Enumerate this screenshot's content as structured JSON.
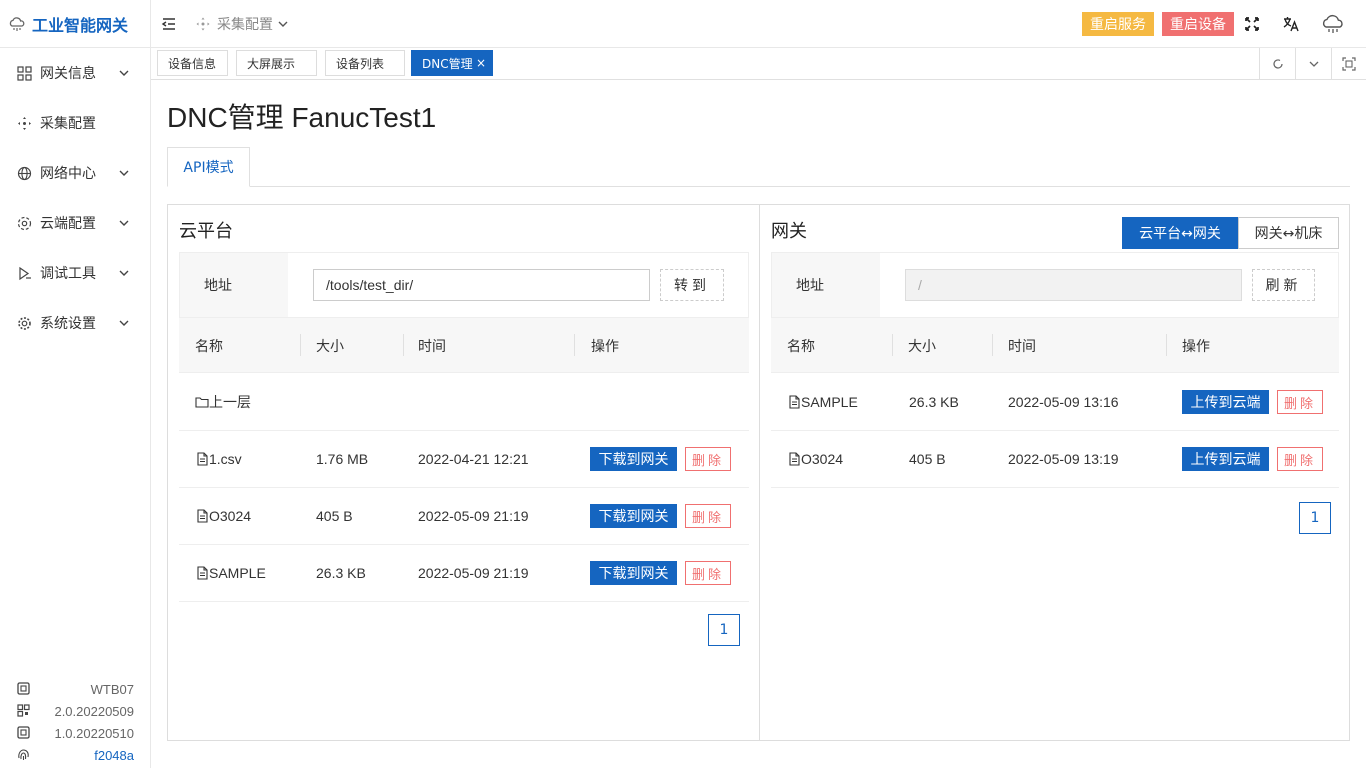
{
  "app": {
    "title": "工业智能网关"
  },
  "sidebar": {
    "items": [
      {
        "label": "网关信息",
        "icon": "grid-icon",
        "has_submenu": true
      },
      {
        "label": "采集配置",
        "icon": "move-icon",
        "has_submenu": false
      },
      {
        "label": "网络中心",
        "icon": "globe-icon",
        "has_submenu": true
      },
      {
        "label": "云端配置",
        "icon": "dataset-icon",
        "has_submenu": true
      },
      {
        "label": "调试工具",
        "icon": "debug-icon",
        "has_submenu": true
      },
      {
        "label": "系统设置",
        "icon": "settings-icon",
        "has_submenu": true
      }
    ],
    "info": [
      {
        "value": "WTB07",
        "icon": "chip-icon"
      },
      {
        "value": "2.0.20220509",
        "icon": "qr-icon"
      },
      {
        "value": "1.0.20220510",
        "icon": "chip-icon"
      },
      {
        "value": "f2048a",
        "icon": "fingerprint-icon"
      }
    ]
  },
  "header": {
    "breadcrumb": "采集配置",
    "restart_service": "重启服务",
    "restart_device": "重启设备"
  },
  "tabs": [
    {
      "label": "设备信息",
      "active": false
    },
    {
      "label": "大屏展示",
      "active": false
    },
    {
      "label": "设备列表",
      "active": false
    },
    {
      "label": "DNC管理",
      "active": true,
      "close": "×"
    }
  ],
  "page": {
    "title": "DNC管理 FanucTest1",
    "mode_tab": "API模式"
  },
  "cloud": {
    "heading": "云平台",
    "addr_label": "地址",
    "addr_value": "/tools/test_dir/",
    "goto_label": "转到",
    "columns": [
      "名称",
      "大小",
      "时间",
      "操作"
    ],
    "parent_label": "上一层",
    "rows": [
      {
        "name": "1.csv",
        "size": "1.76 MB",
        "time": "2022-04-21 12:21"
      },
      {
        "name": "O3024",
        "size": "405 B",
        "time": "2022-05-09 21:19"
      },
      {
        "name": "SAMPLE",
        "size": "26.3 KB",
        "time": "2022-05-09 21:19"
      }
    ],
    "download_label": "下载到网关",
    "delete_label": "删除",
    "page": "1"
  },
  "gateway": {
    "heading": "网关",
    "seg_cloud_gateway": "云平台↔网关",
    "seg_gateway_machine": "网关↔机床",
    "addr_label": "地址",
    "addr_value": "/",
    "refresh_label": "刷新",
    "columns": [
      "名称",
      "大小",
      "时间",
      "操作"
    ],
    "rows": [
      {
        "name": "SAMPLE",
        "size": "26.3 KB",
        "time": "2022-05-09 13:16"
      },
      {
        "name": "O3024",
        "size": "405 B",
        "time": "2022-05-09 13:19"
      }
    ],
    "upload_label": "上传到云端",
    "delete_label": "删除",
    "page": "1"
  },
  "colors": {
    "primary": "#1565c0",
    "warning": "#f5b942",
    "danger": "#f07070"
  }
}
